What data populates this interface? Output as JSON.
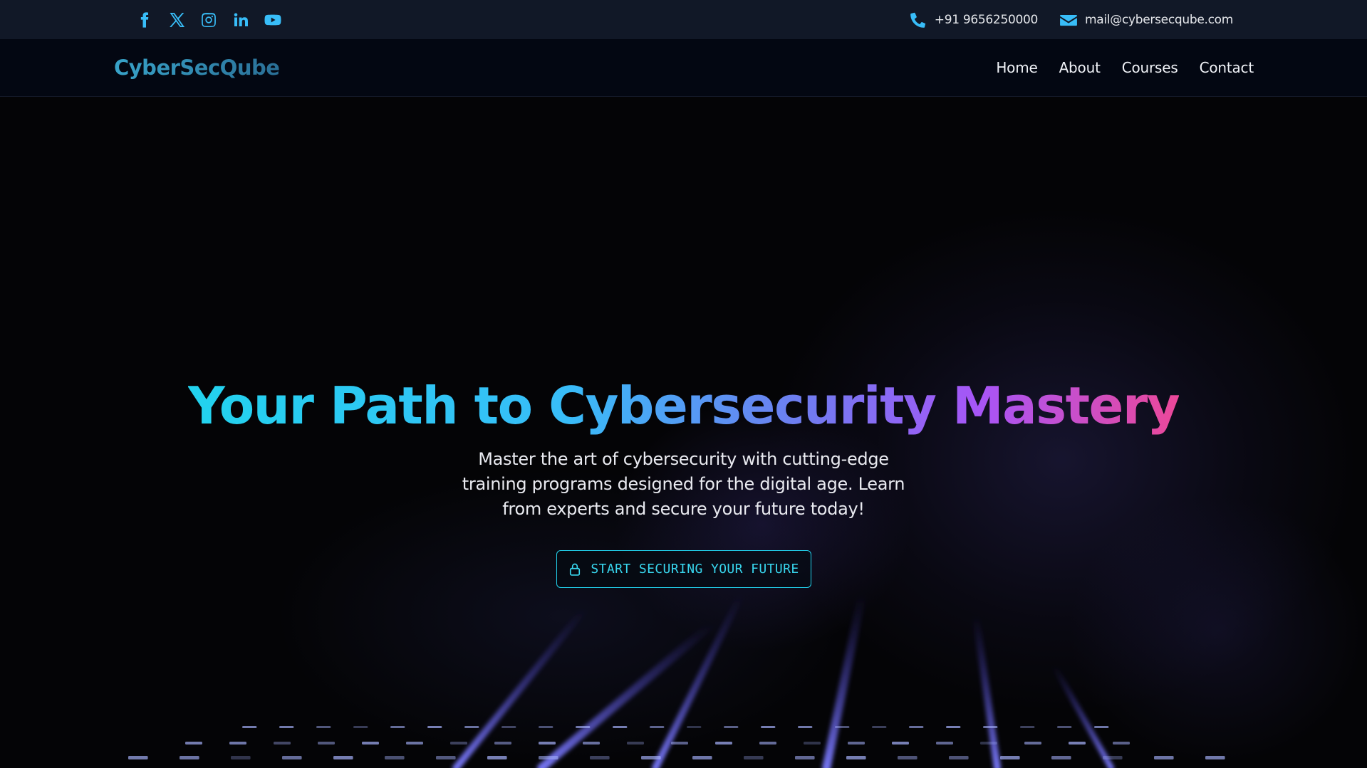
{
  "topbar": {
    "socials": [
      {
        "icon": "facebook-icon"
      },
      {
        "icon": "x-twitter-icon"
      },
      {
        "icon": "instagram-icon"
      },
      {
        "icon": "linkedin-icon"
      },
      {
        "icon": "youtube-icon"
      }
    ],
    "phone": "+91 9656250000",
    "email": "mail@cybersecqube.com",
    "accent_color": "#38bdf8"
  },
  "navbar": {
    "logo": "CyberSecQube",
    "links": [
      "Home",
      "About",
      "Courses",
      "Contact"
    ]
  },
  "hero": {
    "title": "Your Path to Cybersecurity Mastery",
    "subtitle": "Master the art of cybersecurity with cutting-edge training programs designed for the digital age. Learn from experts and secure your future today!",
    "cta_label": "START SECURING YOUR FUTURE",
    "cta_icon": "lock-icon",
    "gradient_colors": [
      "#22d3ee",
      "#38bdf8",
      "#a855f7",
      "#ec4899"
    ]
  }
}
